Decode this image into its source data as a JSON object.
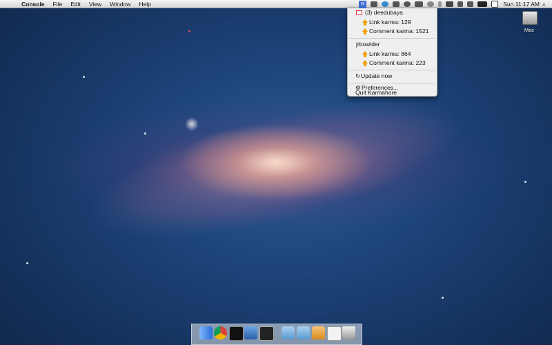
{
  "menubar": {
    "app_name": "Console",
    "items": [
      "File",
      "Edit",
      "View",
      "Window",
      "Help"
    ],
    "clock": "Sun 11:17 AM",
    "karma_icon_label": "R"
  },
  "karma_menu": {
    "accounts": [
      {
        "name": "(3) deedubaya",
        "link_karma": "Link karma: 129",
        "comment_karma": "Comment karma: 1521"
      },
      {
        "name": "jrbowlder",
        "link_karma": "Link karma: 864",
        "comment_karma": "Comment karma: 223"
      }
    ],
    "update": "Update now",
    "preferences": "Preferences...",
    "quit": "Quit Karmahore"
  },
  "desktop": {
    "hd_label": "Mac"
  },
  "dock": {
    "apps": [
      "finder-icon",
      "chrome-icon",
      "terminal-icon",
      "xcode-icon",
      "console-icon",
      "documents-folder-icon",
      "downloads-folder-icon",
      "karmahore-icon",
      "mail-icon",
      "trash-icon"
    ]
  },
  "colors": {
    "menu_accent": "#3d6fd6",
    "karma_arrow": "#f0a000",
    "mail_red": "#d33333"
  }
}
